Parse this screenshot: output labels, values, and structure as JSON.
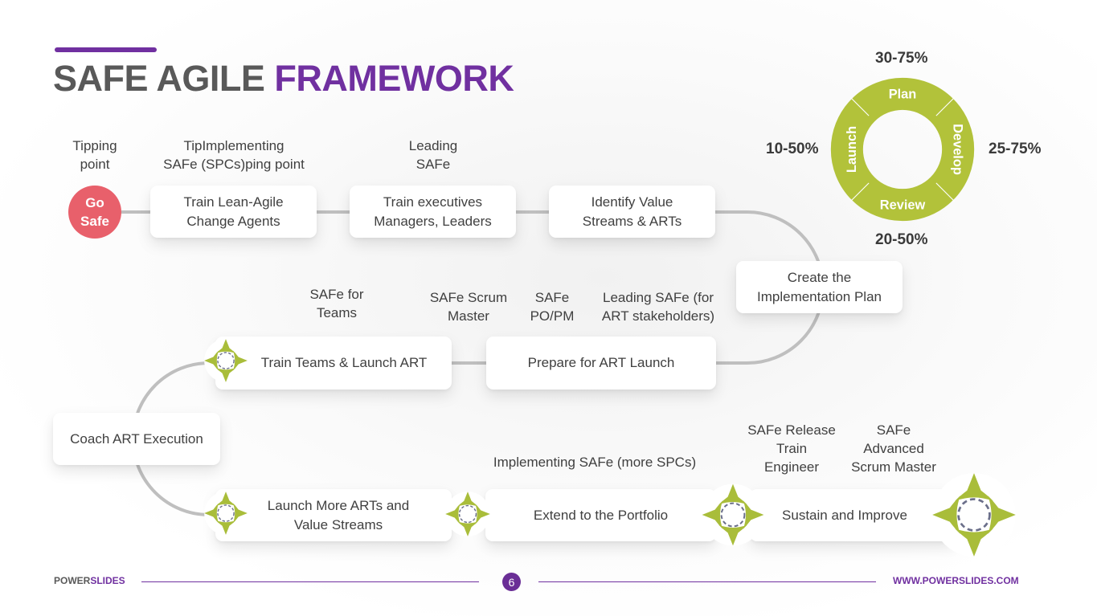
{
  "header": {
    "title_part1": "SAFE AGILE ",
    "title_part2": "FRAMEWORK"
  },
  "colors": {
    "accent_purple": "#7030a0",
    "go_safe_red": "#e8606b",
    "cycle_green": "#b2c23a",
    "connector_gray": "#bfbfbf"
  },
  "start": {
    "label": "Go Safe",
    "line1": "Go",
    "line2": "Safe"
  },
  "top_labels": {
    "tipping_point": [
      "Tipping",
      "point"
    ],
    "implementing_spcs": [
      "TipImplementing",
      "SAFe (SPCs)ping point"
    ],
    "leading_safe": [
      "Leading",
      "SAFe"
    ]
  },
  "row1": [
    {
      "lines": [
        "Train Lean-Agile",
        "Change Agents"
      ]
    },
    {
      "lines": [
        "Train executives",
        "Managers, Leaders"
      ]
    },
    {
      "lines": [
        "Identify Value",
        "Streams & ARTs"
      ]
    }
  ],
  "create_plan": {
    "lines": [
      "Create the",
      "Implementation Plan"
    ]
  },
  "row2_labels": {
    "safe_for_teams": [
      "SAFe for",
      "Teams"
    ],
    "safe_scrum_master": [
      "SAFe Scrum",
      "Master"
    ],
    "safe_popm": [
      "SAFe",
      "PO/PM"
    ],
    "leading_safe_art": [
      "Leading SAFe (for",
      "ART stakeholders)"
    ]
  },
  "row2": [
    {
      "lines": [
        "Train Teams & Launch ART"
      ]
    },
    {
      "lines": [
        "Prepare for ART Launch"
      ]
    }
  ],
  "coach": {
    "lines": [
      "Coach ART Execution"
    ]
  },
  "row3_labels": {
    "implementing_more": [
      "Implementing SAFe (more SPCs)"
    ],
    "safe_rte": [
      "SAFe Release",
      "Train",
      "Engineer"
    ],
    "safe_asm": [
      "SAFe",
      "Advanced",
      "Scrum Master"
    ]
  },
  "row3": [
    {
      "lines": [
        "Launch More ARTs and",
        "Value Streams"
      ]
    },
    {
      "lines": [
        "Extend to the Portfolio"
      ]
    },
    {
      "lines": [
        "Sustain and Improve"
      ]
    }
  ],
  "cycle": {
    "segments": [
      {
        "name": "Plan",
        "range": "30-75%"
      },
      {
        "name": "Develop",
        "range": "25-75%"
      },
      {
        "name": "Review",
        "range": "20-50%"
      },
      {
        "name": "Launch",
        "range": "10-50%"
      }
    ]
  },
  "footer": {
    "brand_part1": "POWER",
    "brand_part2": "SLIDES",
    "page_number": "6",
    "url": "WWW.POWERSLIDES.COM"
  }
}
